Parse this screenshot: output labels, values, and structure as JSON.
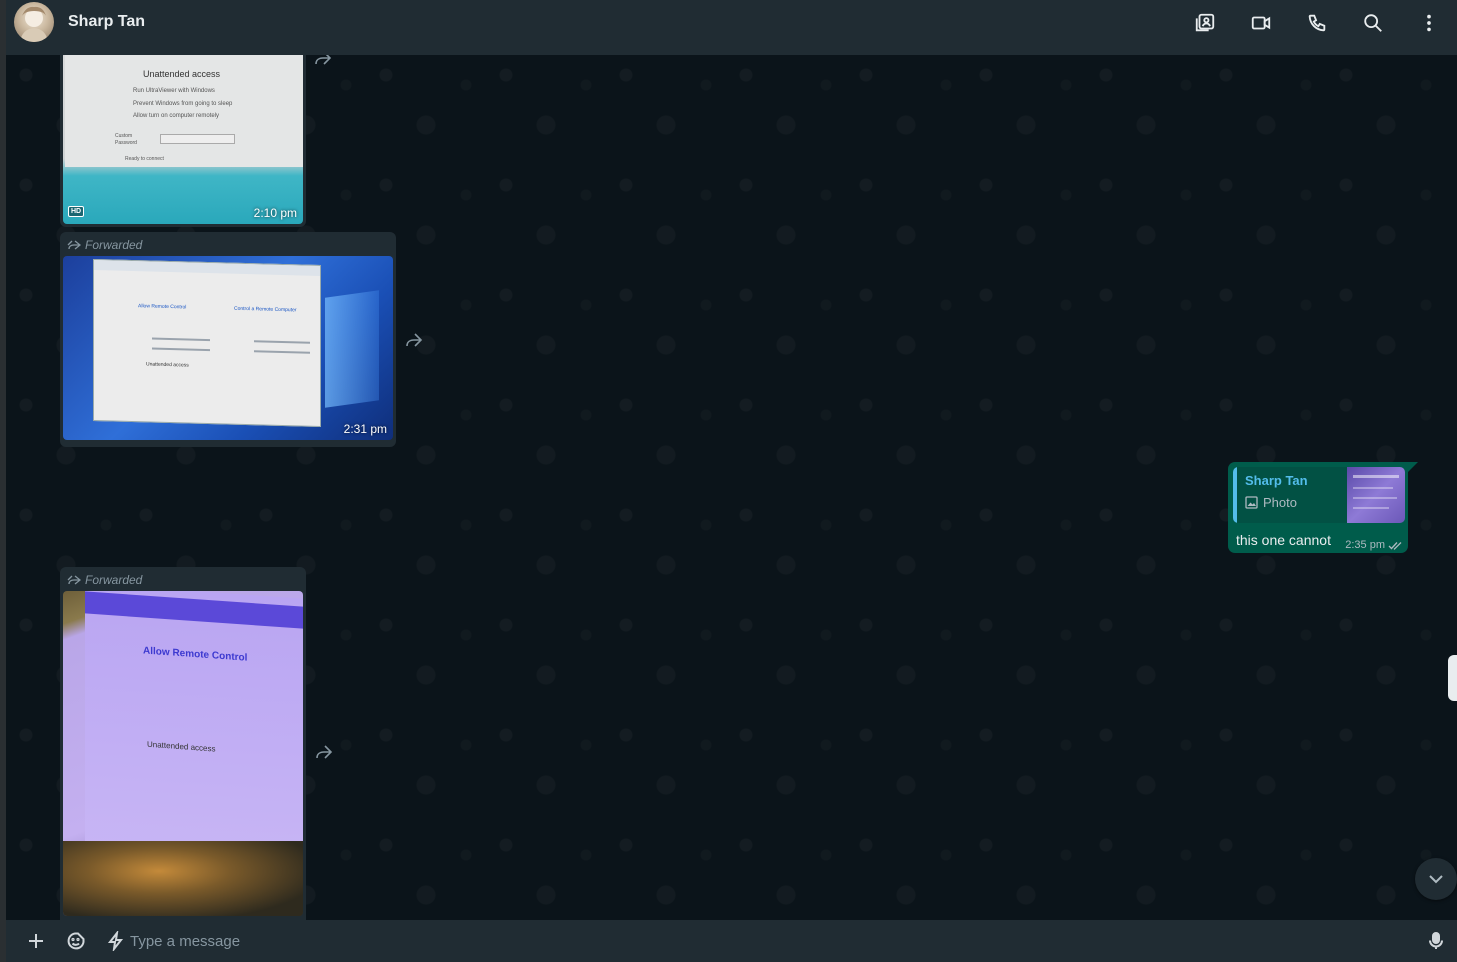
{
  "header": {
    "contact_name": "Sharp Tan",
    "icons": [
      "media-icon",
      "video-call-icon",
      "voice-call-icon",
      "search-icon",
      "menu-icon"
    ]
  },
  "messages": [
    {
      "direction": "in",
      "type": "photo",
      "forwarded": false,
      "badge": "HD",
      "time": "2:10 pm",
      "photo_text": [
        "Unattended access",
        "Run UltraViewer with Windows",
        "Prevent Windows from going to sleep",
        "Allow turn on computer remotely",
        "Custom Password",
        "Ready to connect"
      ]
    },
    {
      "direction": "in",
      "type": "photo",
      "forwarded": true,
      "forwarded_label": "Forwarded",
      "time": "2:31 pm",
      "photo_text": [
        "Allow Remote Control",
        "Control a Remote Computer",
        "Unattended access"
      ]
    },
    {
      "direction": "out",
      "type": "reply",
      "quote": {
        "name": "Sharp Tan",
        "kind": "Photo"
      },
      "text": "this one cannot",
      "time": "2:35 pm",
      "status": "read"
    },
    {
      "direction": "in",
      "type": "photo",
      "forwarded": true,
      "forwarded_label": "Forwarded",
      "photo_text": [
        "Allow Remote Control",
        "Unattended access"
      ]
    }
  ],
  "composer": {
    "placeholder": "Type a message"
  },
  "colors": {
    "header_bg": "#202c33",
    "chat_bg": "#0b141a",
    "incoming_bubble": "#202c33",
    "outgoing_bubble": "#005c4b",
    "quote_accent": "#53bdeb"
  }
}
